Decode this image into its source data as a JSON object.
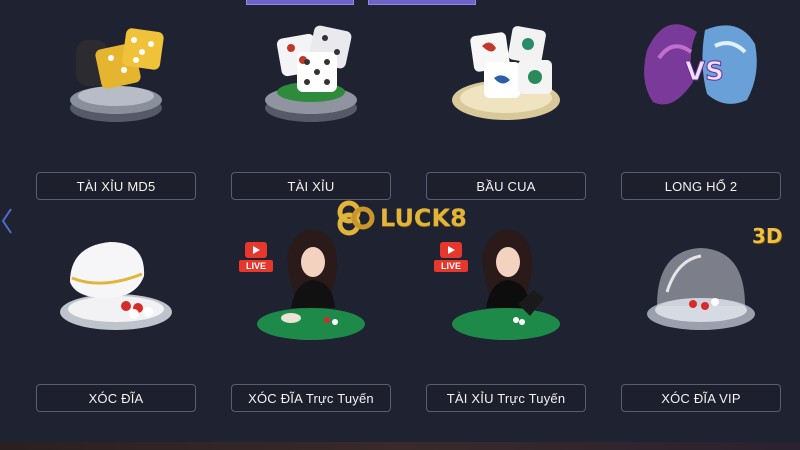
{
  "brand": {
    "name": "LUCK8",
    "badge_3d": "3D"
  },
  "colors": {
    "background": "#1f2230",
    "label_border": "#5a5e70",
    "accent_gold": "#e2b53a",
    "live_red": "#e5372c",
    "felt_green": "#1e8a4a"
  },
  "games": [
    {
      "label": "TÀI XỈU MD5",
      "icon": "gold-dice-icon"
    },
    {
      "label": "TÀI XỈU",
      "icon": "white-dice-icon"
    },
    {
      "label": "BẦU CUA",
      "icon": "bau-cua-dice-icon"
    },
    {
      "label": "LONG HỔ 2",
      "icon": "dragon-tiger-icon"
    },
    {
      "label": "XÓC ĐĨA",
      "icon": "xoc-dia-bowl-icon"
    },
    {
      "label": "XÓC ĐĨA Trực Tuyến",
      "icon": "live-dealer-icon",
      "live": "LIVE"
    },
    {
      "label": "TÀI XỈU Trực Tuyến",
      "icon": "live-dealer-icon",
      "live": "LIVE"
    },
    {
      "label": "XÓC ĐĨA VIP",
      "icon": "glass-dome-icon"
    }
  ]
}
